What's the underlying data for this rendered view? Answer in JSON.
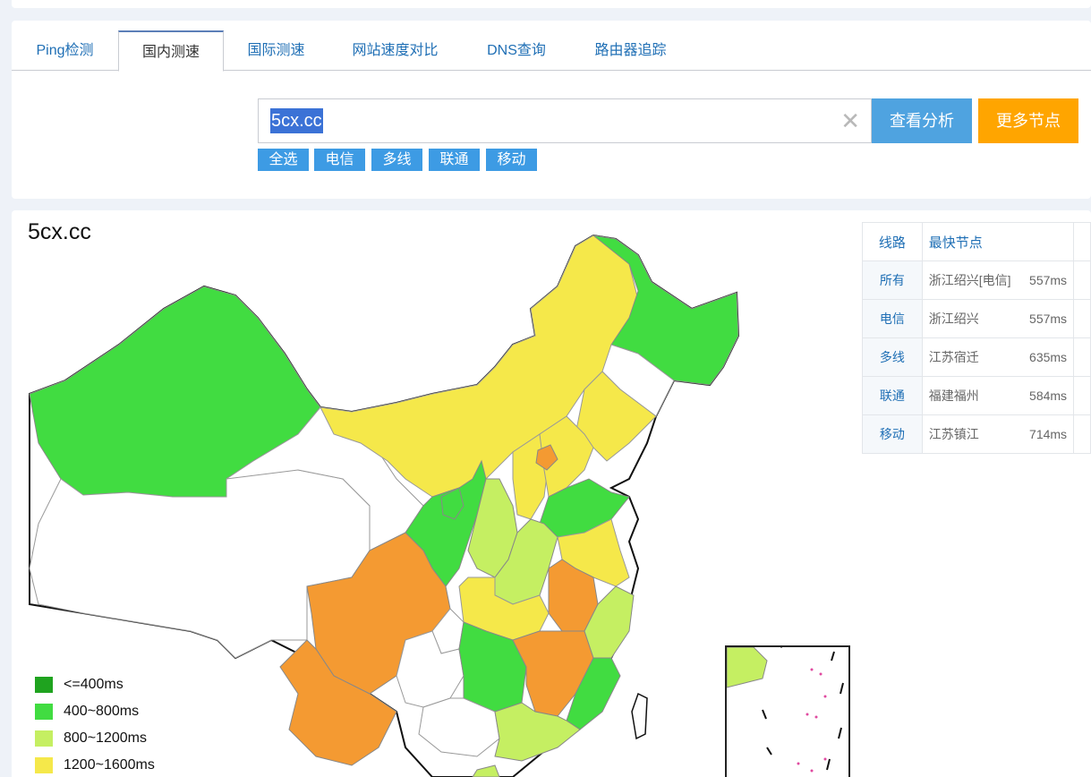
{
  "tabs": [
    "Ping检测",
    "国内测速",
    "国际测速",
    "网站速度对比",
    "DNS查询",
    "路由器追踪"
  ],
  "active_tab": "国内测速",
  "search": {
    "value": "5cx.cc",
    "clear_icon": "close-icon"
  },
  "buttons": {
    "analyze": "查看分析",
    "more_nodes": "更多节点"
  },
  "filters": [
    "全选",
    "电信",
    "多线",
    "联通",
    "移动"
  ],
  "result": {
    "title": "5cx.cc",
    "table": {
      "headers": [
        "线路",
        "最快节点"
      ],
      "rows": [
        {
          "line": "所有",
          "node": "浙江绍兴[电信]",
          "ms": "557ms"
        },
        {
          "line": "电信",
          "node": "浙江绍兴",
          "ms": "557ms"
        },
        {
          "line": "多线",
          "node": "江苏宿迁",
          "ms": "635ms"
        },
        {
          "line": "联通",
          "node": "福建福州",
          "ms": "584ms"
        },
        {
          "line": "移动",
          "node": "江苏镇江",
          "ms": "714ms"
        }
      ]
    },
    "legend": [
      {
        "label": "<=400ms",
        "color": "#1fa31f"
      },
      {
        "label": "400~800ms",
        "color": "#41dc41"
      },
      {
        "label": "800~1200ms",
        "color": "#c5ef62"
      },
      {
        "label": "1200~1600ms",
        "color": "#f5e84a"
      }
    ],
    "map_colors": {
      "green": "#41dc41",
      "lightgreen": "#c5ef62",
      "yellow": "#f5e84a",
      "orange": "#f49a32",
      "white": "#ffffff"
    }
  }
}
